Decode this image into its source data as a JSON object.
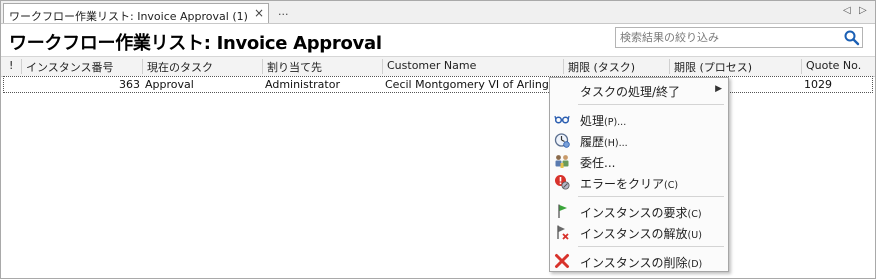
{
  "tab": {
    "label": "ワークフロー作業リスト: Invoice Approval (1)",
    "close": "×",
    "more": "..."
  },
  "nav": {
    "left": "◁",
    "right": "▷"
  },
  "page": {
    "title": "ワークフロー作業リスト: Invoice Approval"
  },
  "search": {
    "placeholder": "検索結果の絞り込み"
  },
  "columns": {
    "flag": "!",
    "instance_no": "インスタンス番号",
    "current_task": "現在のタスク",
    "assignee": "割り当て先",
    "customer_name": "Customer Name",
    "deadline_task": "期限 (タスク)",
    "deadline_process": "期限 (プロセス)",
    "quote_no": "Quote No."
  },
  "rows": [
    {
      "instance_no": "363",
      "current_task": "Approval",
      "assignee": "Administrator",
      "customer_name": "Cecil Montgomery VI of Arlington",
      "quote_no": "1029"
    }
  ],
  "menu": {
    "process_finish": "タスクの処理/終了",
    "process": "処理",
    "process_acc": "(P)...",
    "history": "履歴",
    "history_acc": "(H)...",
    "delegate": "委任...",
    "clear_error": "エラーをクリア",
    "clear_error_acc": "(C)",
    "request": "インスタンスの要求",
    "request_acc": "(C)",
    "release": "インスタンスの解放",
    "release_acc": "(U)",
    "delete": "インスタンスの削除",
    "delete_acc": "(D)"
  },
  "icons": {
    "submenu": "chevron-right-icon",
    "process": "glasses-icon",
    "history": "clock-icon",
    "delegate": "users-icon",
    "clear_error": "error-icon",
    "request": "flag-icon",
    "release": "flag-remove-icon",
    "delete": "delete-icon",
    "search": "search-icon"
  },
  "colors": {
    "accent": "#1a5fb4",
    "error": "#d8322b",
    "flag_green": "#3aa53a"
  }
}
